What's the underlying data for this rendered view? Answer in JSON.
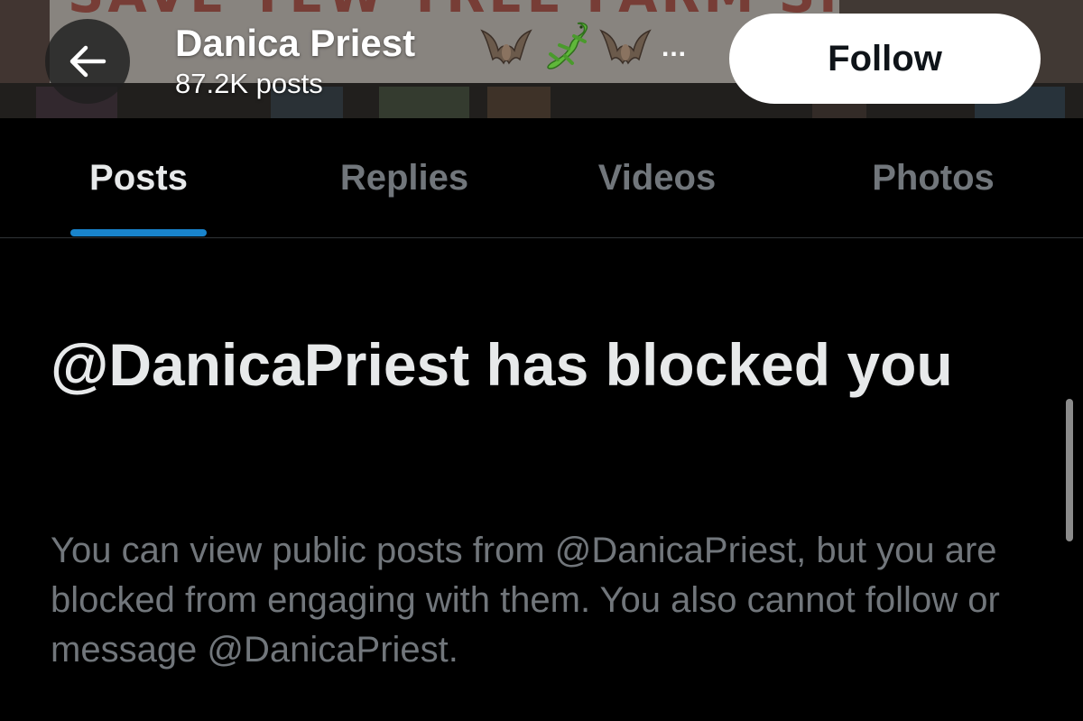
{
  "header": {
    "banner_sign_text": "SAVE YEW TREE FARM SNOW",
    "back_icon": "arrow-left-icon",
    "name": "Danica Priest",
    "name_emojis": [
      "bat-emoji",
      "lizard-emoji",
      "bat-emoji"
    ],
    "name_ellipsis": "...",
    "post_count": "87.2K posts",
    "follow_label": "Follow"
  },
  "tabs": [
    {
      "label": "Posts",
      "active": true
    },
    {
      "label": "Replies",
      "active": false
    },
    {
      "label": "Videos",
      "active": false
    },
    {
      "label": "Photos",
      "active": false
    }
  ],
  "notice": {
    "title": "@DanicaPriest has blocked you",
    "description": "You can view public posts from @DanicaPriest, but you are blocked from engaging with them. You also cannot follow or message @DanicaPriest."
  },
  "colors": {
    "background": "#000000",
    "tab_indicator": "#1d9bf0",
    "text_primary": "#e7e9ea",
    "text_secondary": "#71767b",
    "follow_button_bg": "#ffffff"
  }
}
